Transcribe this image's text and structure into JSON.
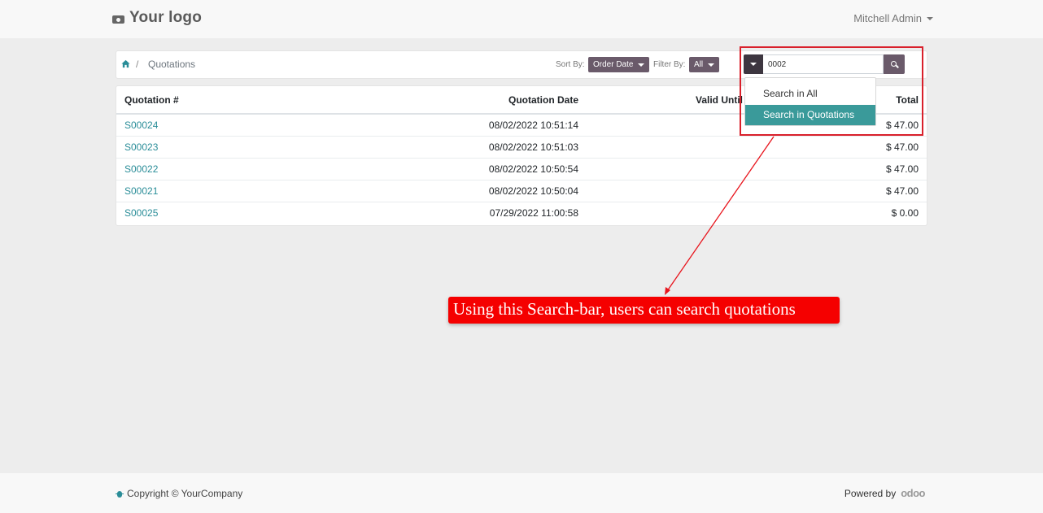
{
  "header": {
    "logo_text": "Your logo",
    "user_name": "Mitchell Admin"
  },
  "breadcrumb": {
    "home_icon": "home-icon",
    "separator": "/",
    "current": "Quotations"
  },
  "toolbar": {
    "sort_label": "Sort By:",
    "sort_value": "Order Date",
    "filter_label": "Filter By:",
    "filter_value": "All"
  },
  "search": {
    "value": "0002",
    "options": [
      "Search in All",
      "Search in Quotations"
    ],
    "selected": "Search in Quotations"
  },
  "table": {
    "columns": [
      "Quotation #",
      "Quotation Date",
      "Valid Until",
      "Total"
    ],
    "rows": [
      {
        "number": "S00024",
        "date": "08/02/2022 10:51:14",
        "valid_until": "",
        "total": "$ 47.00"
      },
      {
        "number": "S00023",
        "date": "08/02/2022 10:51:03",
        "valid_until": "",
        "total": "$ 47.00"
      },
      {
        "number": "S00022",
        "date": "08/02/2022 10:50:54",
        "valid_until": "",
        "total": "$ 47.00"
      },
      {
        "number": "S00021",
        "date": "08/02/2022 10:50:04",
        "valid_until": "",
        "total": "$ 47.00"
      },
      {
        "number": "S00025",
        "date": "07/29/2022 11:00:58",
        "valid_until": "",
        "total": "$ 0.00"
      }
    ]
  },
  "annotation": {
    "text": "Using this Search-bar, users can search quotations",
    "color": "#f50000"
  },
  "footer": {
    "copyright": "Copyright © YourCompany",
    "powered_by": "Powered by",
    "brand": "odoo"
  },
  "colors": {
    "accent": "#2a8d98",
    "highlight": "#3a9a9a",
    "button": "#6a5a6a"
  }
}
